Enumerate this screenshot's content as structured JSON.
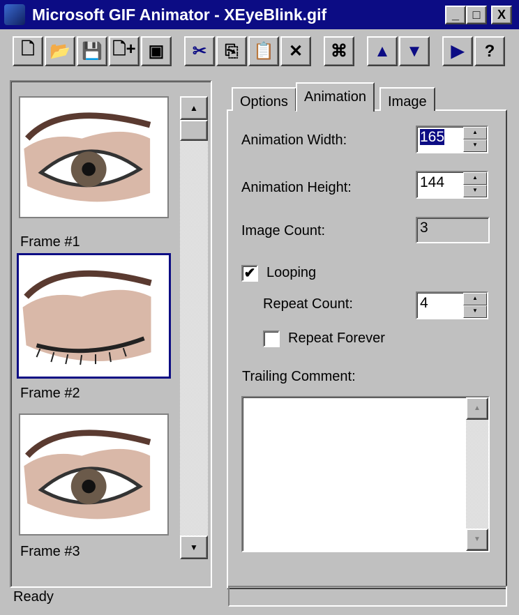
{
  "window": {
    "title": "Microsoft GIF Animator - XEyeBlink.gif",
    "minimize": "_",
    "maximize": "□",
    "close": "X"
  },
  "toolbar": [
    {
      "name": "new-button",
      "icon": "new-document-icon",
      "glyph": "🗋"
    },
    {
      "name": "open-button",
      "icon": "open-folder-icon",
      "glyph": "📂"
    },
    {
      "name": "save-button",
      "icon": "save-disk-icon",
      "glyph": "💾"
    },
    {
      "name": "insert-button",
      "icon": "insert-document-icon",
      "glyph": "🗋+"
    },
    {
      "name": "save-as-button",
      "icon": "save-multiple-icon",
      "glyph": "▣"
    },
    {
      "name": "cut-button",
      "icon": "scissors-icon",
      "glyph": "✂"
    },
    {
      "name": "copy-button",
      "icon": "copy-icon",
      "glyph": "⎘"
    },
    {
      "name": "paste-button",
      "icon": "paste-icon",
      "glyph": "📋"
    },
    {
      "name": "delete-button",
      "icon": "delete-x-icon",
      "glyph": "✕"
    },
    {
      "name": "select-all-button",
      "icon": "select-frames-icon",
      "glyph": "⌘"
    },
    {
      "name": "move-up-button",
      "icon": "arrow-up-icon",
      "glyph": "▲"
    },
    {
      "name": "move-down-button",
      "icon": "arrow-down-icon",
      "glyph": "▼"
    },
    {
      "name": "preview-button",
      "icon": "play-icon",
      "glyph": "▶"
    },
    {
      "name": "help-button",
      "icon": "help-icon",
      "glyph": "?"
    }
  ],
  "frames": [
    {
      "label": "Frame #1"
    },
    {
      "label": "Frame #2"
    },
    {
      "label": "Frame #3"
    }
  ],
  "tabs": [
    {
      "label": "Options"
    },
    {
      "label": "Animation"
    },
    {
      "label": "Image"
    }
  ],
  "animation": {
    "width_label": "Animation Width:",
    "width_value": "165",
    "height_label": "Animation Height:",
    "height_value": "144",
    "count_label": "Image Count:",
    "count_value": "3",
    "looping_label": "Looping",
    "looping_checked": "✔",
    "repeat_label": "Repeat Count:",
    "repeat_value": "4",
    "forever_label": "Repeat Forever",
    "comment_label": "Trailing Comment:",
    "comment_value": ""
  },
  "status": {
    "text": "Ready"
  },
  "colors": {
    "titlebar": "#0c0c84",
    "selection": "#0c0c84"
  }
}
